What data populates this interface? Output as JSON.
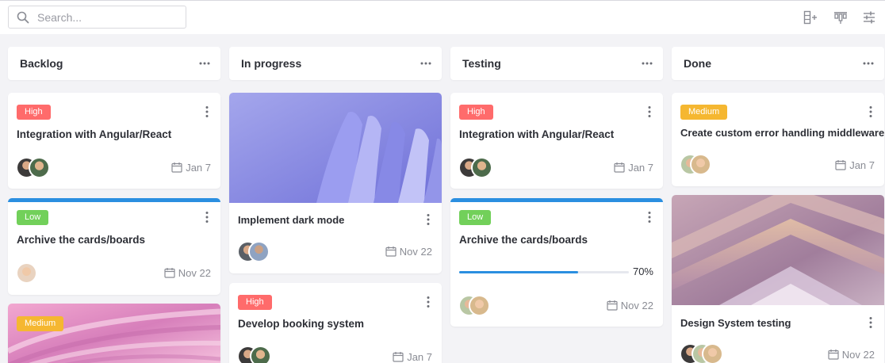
{
  "search": {
    "placeholder": "Search..."
  },
  "toolbar": {
    "icons": [
      "add-column-icon",
      "board-layout-icon",
      "filter-settings-icon"
    ]
  },
  "columns": [
    {
      "title": "Backlog"
    },
    {
      "title": "In progress"
    },
    {
      "title": "Testing"
    },
    {
      "title": "Done"
    }
  ],
  "cards": {
    "backlog_1": {
      "badge": "High",
      "title": "Integration with Angular/React",
      "date": "Jan 7"
    },
    "backlog_2": {
      "badge": "Low",
      "title": "Archive the cards/boards",
      "date": "Nov 22"
    },
    "backlog_3": {
      "badge": "Medium"
    },
    "progress_1": {
      "title": "Implement dark mode",
      "date": "Nov 22"
    },
    "progress_2": {
      "badge": "High",
      "title": "Develop booking system",
      "date": "Jan 7"
    },
    "testing_1": {
      "badge": "High",
      "title": "Integration with Angular/React",
      "date": "Jan 7"
    },
    "testing_2": {
      "badge": "Low",
      "title": "Archive the cards/boards",
      "progress": "70%",
      "date": "Nov 22"
    },
    "done_1": {
      "badge": "Medium",
      "title": "Create custom error handling middleware",
      "date": "Jan 7"
    },
    "done_2": {
      "title": "Design System testing",
      "date": "Nov 22"
    }
  },
  "colors": {
    "high": "#ff6b6b",
    "low": "#72d05a",
    "medium": "#f5b731",
    "accent": "#2b8fe0"
  }
}
